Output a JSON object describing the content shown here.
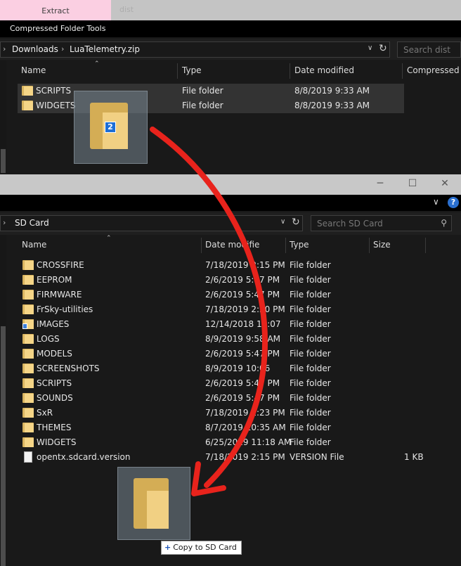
{
  "top_window": {
    "ribbon": {
      "context_tab": "Extract",
      "dim_tab": "dist",
      "tools_label": "Compressed Folder Tools"
    },
    "breadcrumb": [
      "Downloads",
      "LuaTelemetry.zip"
    ],
    "search": {
      "placeholder": "Search dist"
    },
    "columns": {
      "name": "Name",
      "type": "Type",
      "date": "Date modified",
      "compressed": "Compressed si"
    },
    "rows": [
      {
        "name": "SCRIPTS",
        "type": "File folder",
        "date": "8/8/2019 9:33 AM"
      },
      {
        "name": "WIDGETS",
        "type": "File folder",
        "date": "8/8/2019 9:33 AM"
      }
    ],
    "drag_count": "2"
  },
  "bottom_window": {
    "window_controls": {
      "minimize": "─",
      "maximize": "☐",
      "close": "✕"
    },
    "help": "?",
    "breadcrumb": [
      "SD Card"
    ],
    "search": {
      "placeholder": "Search SD Card"
    },
    "columns": {
      "name": "Name",
      "date": "Date modifie",
      "type": "Type",
      "size": "Size"
    },
    "rows": [
      {
        "name": "CROSSFIRE",
        "date": "7/18/2019 2:15 PM",
        "type": "File folder",
        "size": "",
        "icon": "folder"
      },
      {
        "name": "EEPROM",
        "date": "2/6/2019 5:47 PM",
        "type": "File folder",
        "size": "",
        "icon": "folder"
      },
      {
        "name": "FIRMWARE",
        "date": "2/6/2019 5:47 PM",
        "type": "File folder",
        "size": "",
        "icon": "folder"
      },
      {
        "name": "FrSky-utilities",
        "date": "7/18/2019 2:20 PM",
        "type": "File folder",
        "size": "",
        "icon": "folder"
      },
      {
        "name": "IMAGES",
        "date": "12/14/2018 11:07",
        "type": "File folder",
        "size": "",
        "icon": "image-folder"
      },
      {
        "name": "LOGS",
        "date": "8/9/2019 9:58 AM",
        "type": "File folder",
        "size": "",
        "icon": "folder"
      },
      {
        "name": "MODELS",
        "date": "2/6/2019 5:47 PM",
        "type": "File folder",
        "size": "",
        "icon": "folder"
      },
      {
        "name": "SCREENSHOTS",
        "date": "8/9/2019 10:06",
        "type": "File folder",
        "size": "",
        "icon": "folder"
      },
      {
        "name": "SCRIPTS",
        "date": "2/6/2019 5:47 PM",
        "type": "File folder",
        "size": "",
        "icon": "folder"
      },
      {
        "name": "SOUNDS",
        "date": "2/6/2019 5:47 PM",
        "type": "File folder",
        "size": "",
        "icon": "folder"
      },
      {
        "name": "SxR",
        "date": "7/18/2019 2:23 PM",
        "type": "File folder",
        "size": "",
        "icon": "folder"
      },
      {
        "name": "THEMES",
        "date": "8/7/2019 10:35 AM",
        "type": "File folder",
        "size": "",
        "icon": "folder"
      },
      {
        "name": "WIDGETS",
        "date": "6/25/2019 11:18 AM",
        "type": "File folder",
        "size": "",
        "icon": "folder"
      },
      {
        "name": "opentx.sdcard.version",
        "date": "7/18/2019 2:15 PM",
        "type": "VERSION File",
        "size": "1 KB",
        "icon": "file"
      }
    ],
    "copy_tooltip": {
      "plus": "+",
      "text": "Copy to SD Card"
    }
  },
  "colors": {
    "arrow": "#e8231c",
    "folder": "#f5d587",
    "badge": "#1d6ed6"
  }
}
